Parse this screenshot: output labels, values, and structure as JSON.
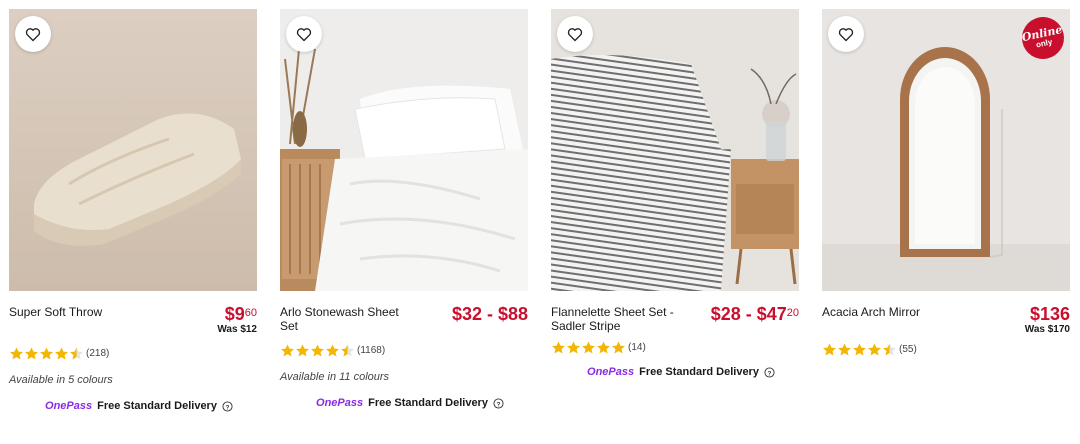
{
  "products": [
    {
      "name": "Super Soft Throw",
      "price_main": "$9",
      "price_cents": "60",
      "was": "Was $12",
      "rating_stars": 4.5,
      "reviews": "(218)",
      "availability": "Available in 5 colours",
      "onepass": "OnePass",
      "delivery": "Free Standard Delivery"
    },
    {
      "name": "Arlo Stonewash Sheet Set",
      "price_main": "$32 - $88",
      "rating_stars": 4.5,
      "reviews": "(1168)",
      "availability": "Available in 11 colours",
      "onepass": "OnePass",
      "delivery": "Free Standard Delivery"
    },
    {
      "name": "Flannelette Sheet Set - Sadler Stripe",
      "price_main": "$28 - $47",
      "price_cents": "20",
      "rating_stars": 5,
      "reviews": "(14)",
      "onepass": "OnePass",
      "delivery": "Free Standard Delivery"
    },
    {
      "name": "Acacia Arch Mirror",
      "price_main": "$136",
      "was": "Was $170",
      "rating_stars": 4.5,
      "reviews": "(55)",
      "badge_line1": "Online",
      "badge_line2": "only"
    }
  ],
  "colors": {
    "price": "#c8102e",
    "star": "#f2b705",
    "onepass": "#8a2be2"
  },
  "icons": {
    "wishlist": "heart-outline-icon",
    "info": "info-circle-icon",
    "star": "star-icon"
  }
}
